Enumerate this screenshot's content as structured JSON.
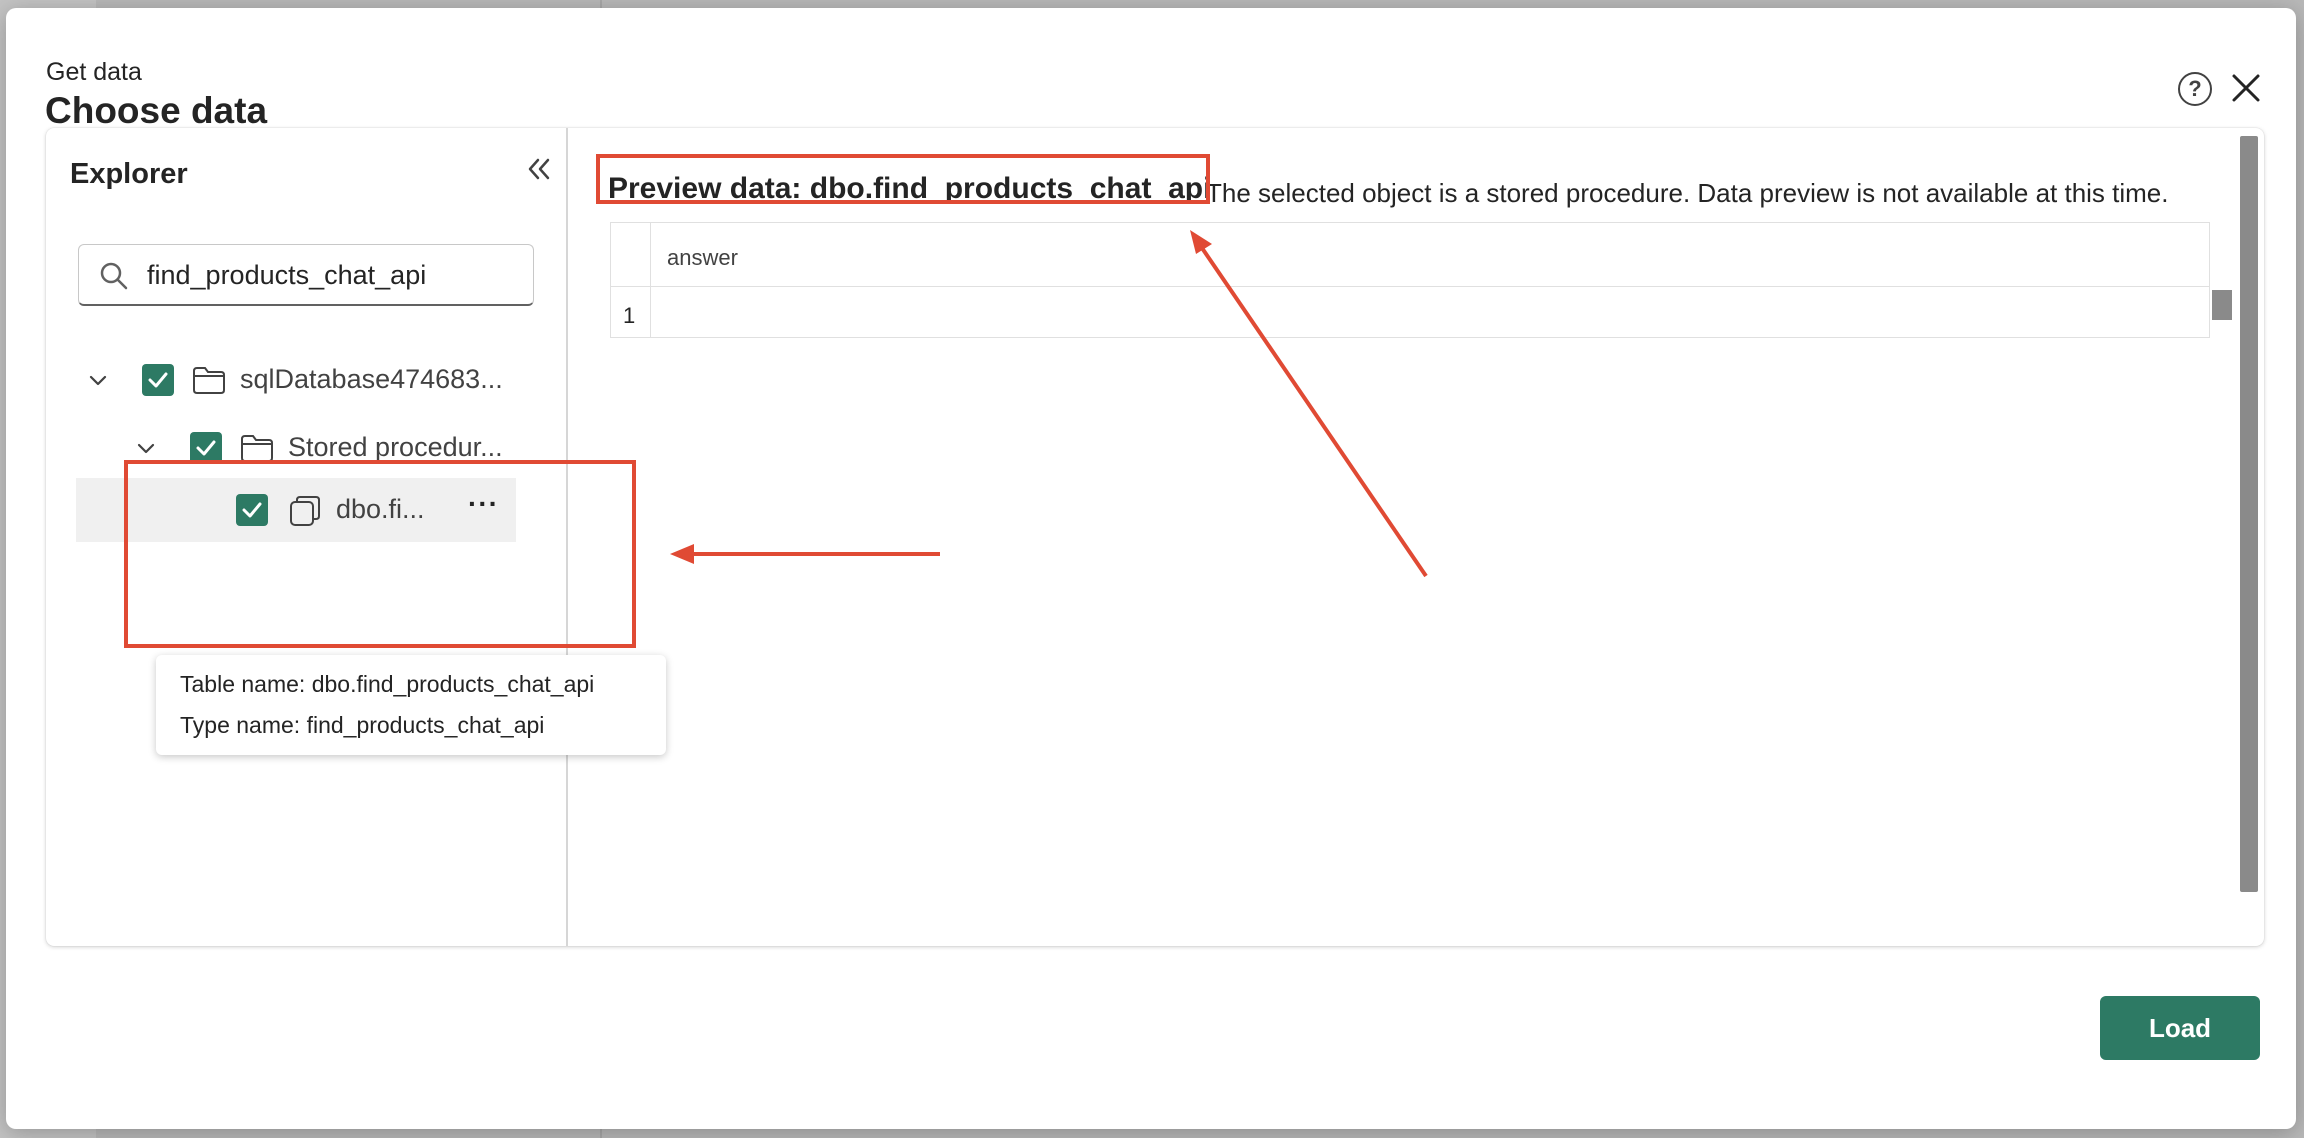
{
  "dialog": {
    "breadcrumb": "Get data",
    "title": "Choose data",
    "help_label": "?"
  },
  "explorer": {
    "title": "Explorer",
    "search": {
      "value": "find_products_chat_api",
      "placeholder": ""
    },
    "tree": [
      {
        "label": "sqlDatabase474683...",
        "checked": true,
        "expanded": true
      },
      {
        "label": "Stored procedur...",
        "checked": true,
        "expanded": true
      },
      {
        "label": "dbo.fi...",
        "checked": true,
        "more": "···"
      }
    ],
    "tooltip": {
      "table_name": "Table name: dbo.find_products_chat_api",
      "type_name": "Type name: find_products_chat_api"
    }
  },
  "preview": {
    "title": "Preview data: dbo.find_products_chat_api",
    "note": "The selected object is a stored procedure. Data preview is not available at this time.",
    "columns": [
      "answer"
    ],
    "rows": [
      [
        "1",
        ""
      ]
    ]
  },
  "footer": {
    "load_label": "Load"
  },
  "colors": {
    "accent": "#2d7a64",
    "annotation": "#e04a34"
  }
}
